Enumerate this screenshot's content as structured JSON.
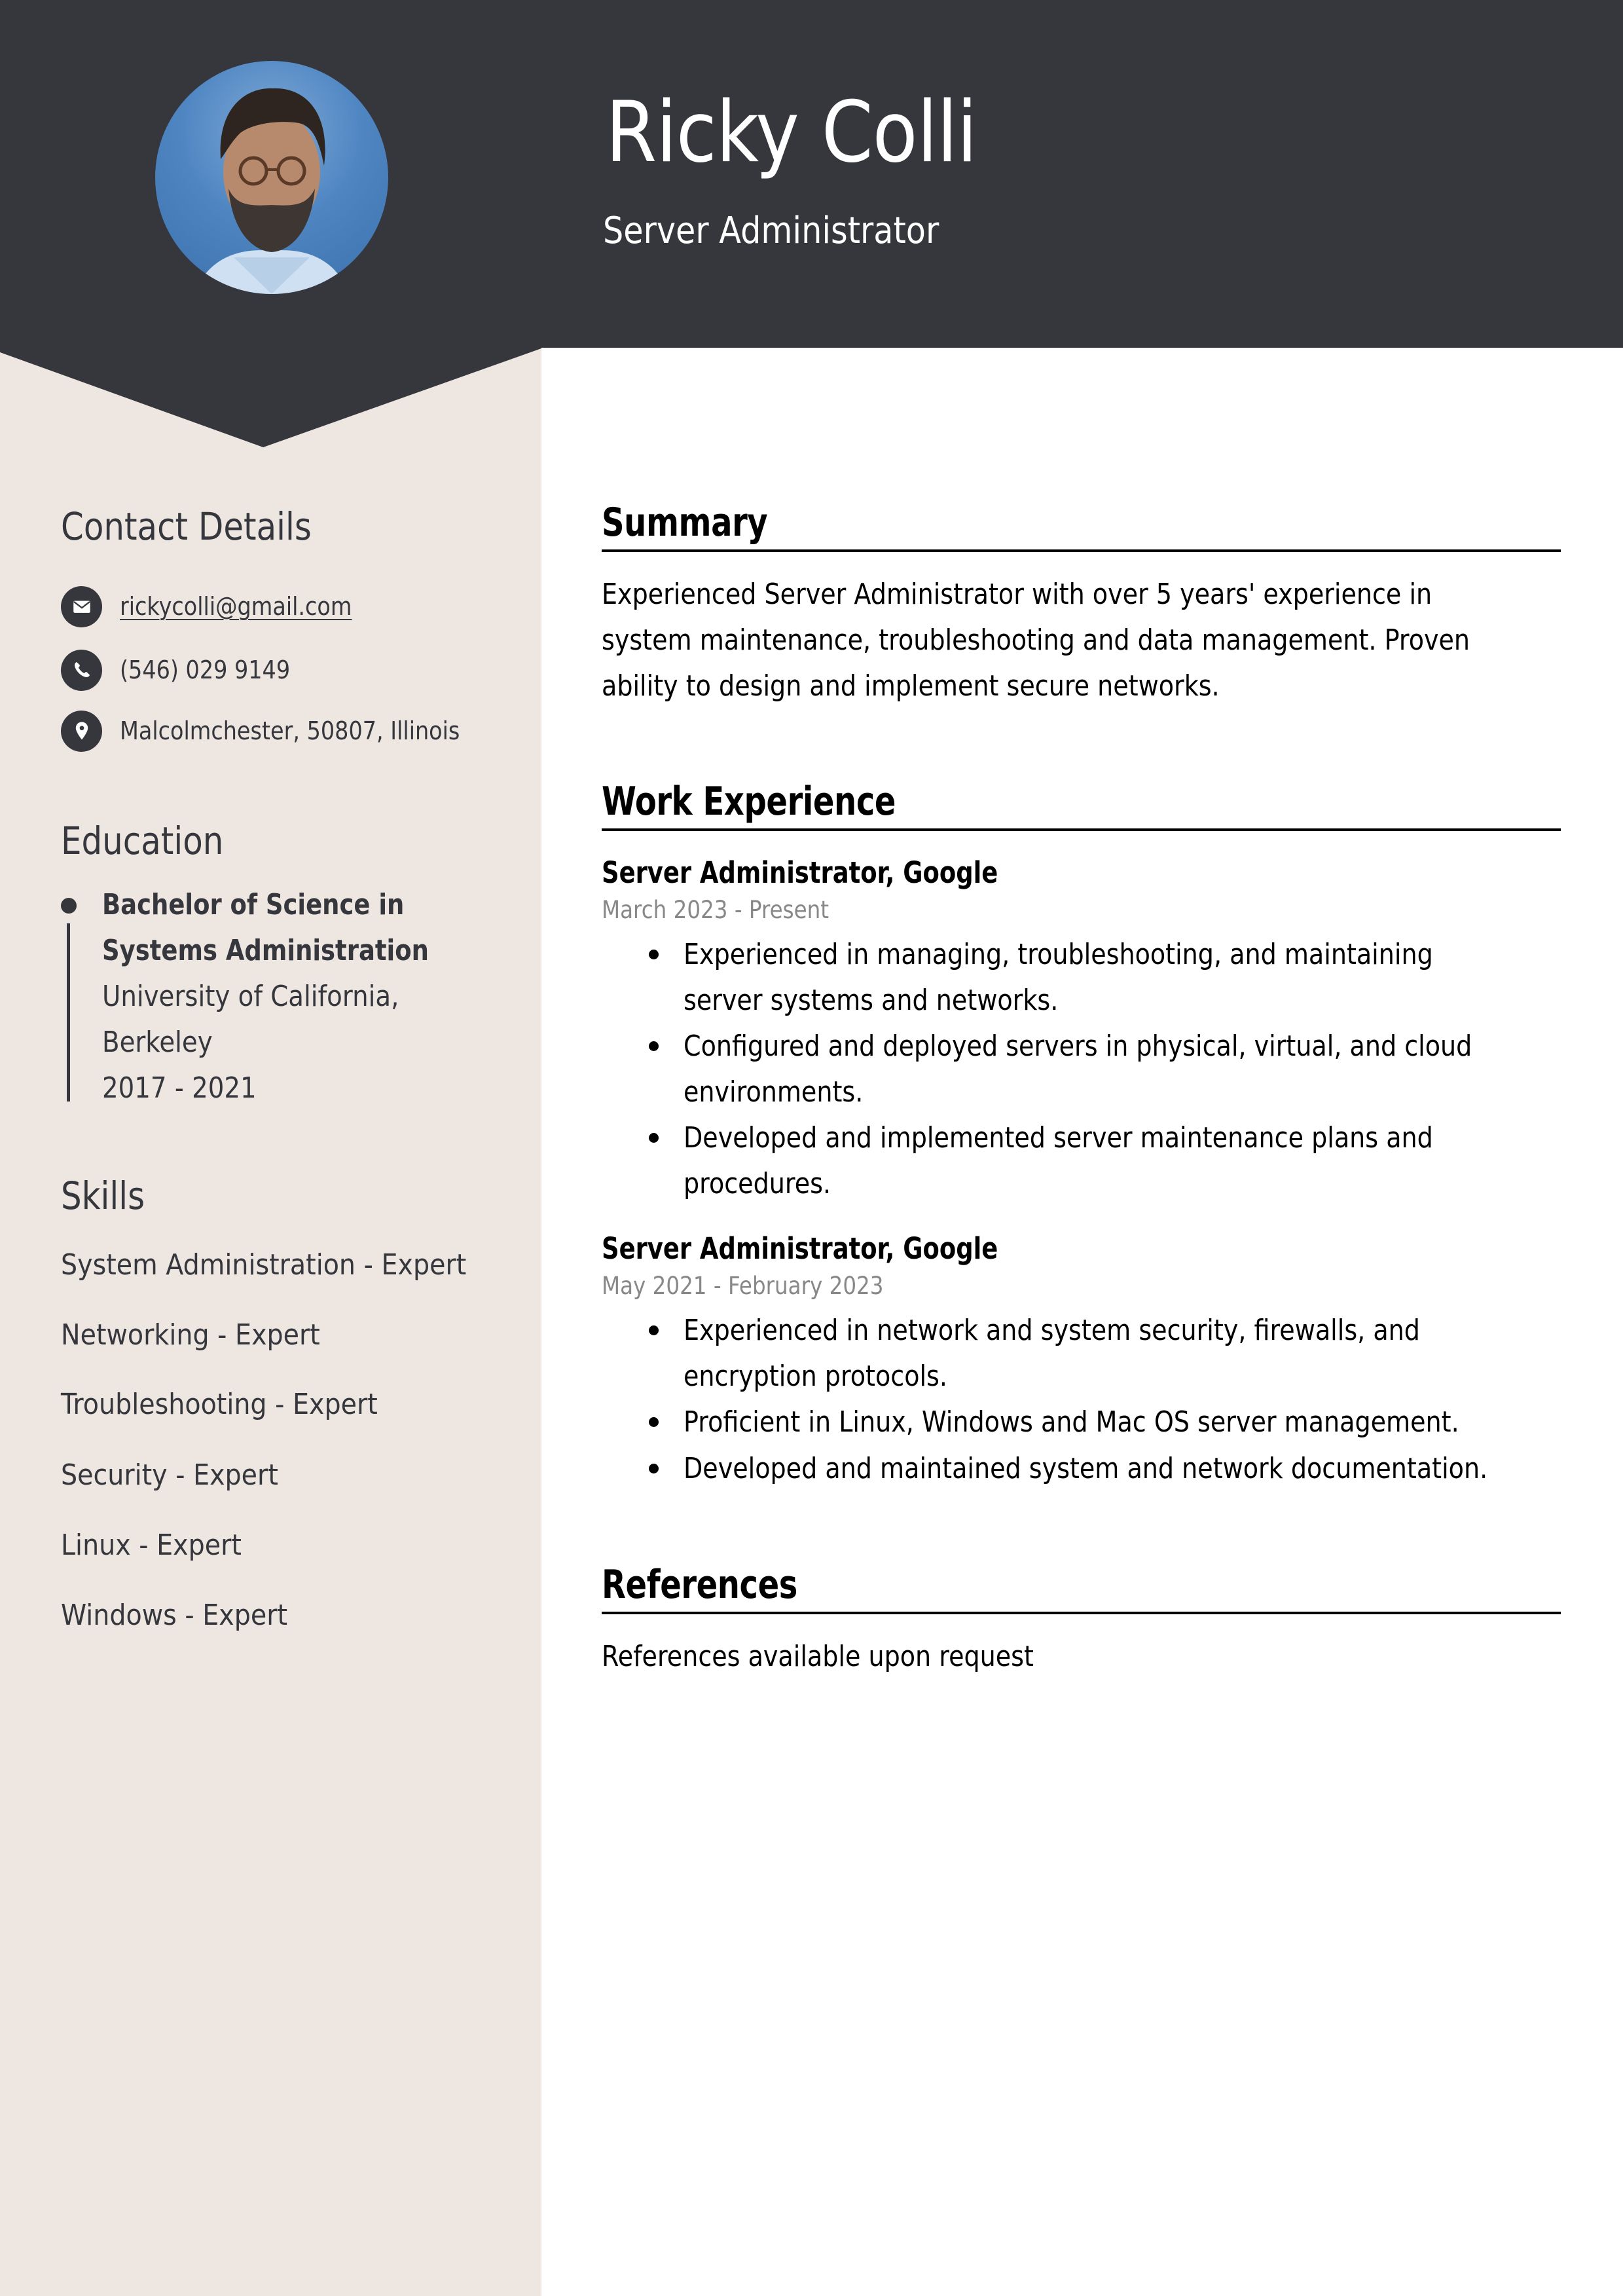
{
  "header": {
    "name": "Ricky Colli",
    "title": "Server Administrator",
    "photo_alt": "Profile photo of Ricky Colli"
  },
  "colors": {
    "header_bg": "#36373D",
    "sidebar_bg": "#EDE6E1",
    "sidebar_text": "#36373D",
    "main_text": "#000000",
    "date_text": "#888888"
  },
  "sidebar": {
    "contact": {
      "heading": "Contact Details",
      "items": [
        {
          "icon": "envelope-icon",
          "text": "rickycolli@gmail.com",
          "is_link": true
        },
        {
          "icon": "phone-icon",
          "text": "(546) 029 9149",
          "is_link": false
        },
        {
          "icon": "location-pin-icon",
          "text": "Malcolmchester, 50807, Illinois",
          "is_link": false
        }
      ]
    },
    "education": {
      "heading": "Education",
      "entries": [
        {
          "degree_lines": [
            "Bachelor of Science in",
            "Systems Administration"
          ],
          "school_lines": [
            "University of California,",
            "Berkeley"
          ],
          "years": "2017 - 2021"
        }
      ]
    },
    "skills": {
      "heading": "Skills",
      "items": [
        "System Administration - Expert",
        "Networking - Expert",
        "Troubleshooting - Expert",
        "Security - Expert",
        "Linux - Expert",
        "Windows - Expert"
      ]
    }
  },
  "main": {
    "summary": {
      "heading": "Summary",
      "lines": [
        "Experienced Server Administrator with over 5 years' experience in",
        "system maintenance, troubleshooting and data management. Proven",
        "ability to design and implement secure networks."
      ]
    },
    "work": {
      "heading": "Work Experience",
      "jobs": [
        {
          "title": "Server Administrator, Google",
          "dates": "March 2023 - Present",
          "bullets": [
            [
              "Experienced in managing, troubleshooting, and maintaining",
              "server systems and networks."
            ],
            [
              "Configured and deployed servers in physical, virtual, and cloud",
              "environments."
            ],
            [
              "Developed and implemented server maintenance plans and",
              "procedures."
            ]
          ]
        },
        {
          "title": "Server Administrator, Google",
          "dates": "May 2021 - February 2023",
          "bullets": [
            [
              "Experienced in network and system security, firewalls, and",
              "encryption protocols."
            ],
            [
              "Proficient in Linux, Windows and Mac OS server management."
            ],
            [
              "Developed and maintained system and network documentation."
            ]
          ]
        }
      ]
    },
    "references": {
      "heading": "References",
      "text": "References available upon request"
    }
  }
}
